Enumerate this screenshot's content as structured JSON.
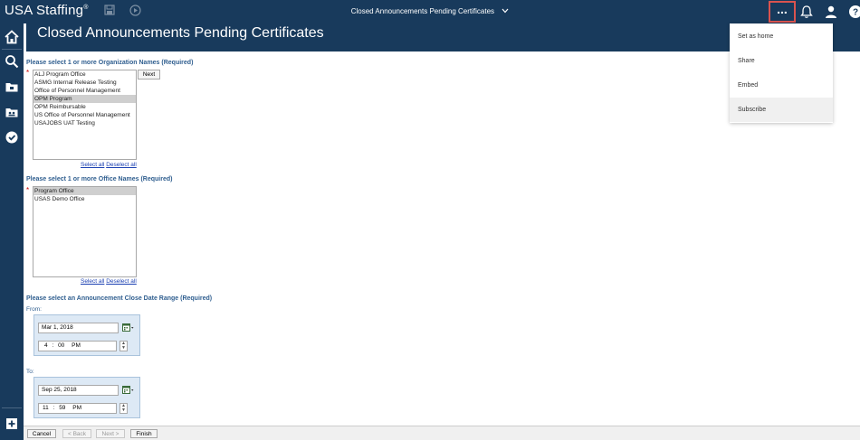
{
  "app": {
    "brand": "USA Staffing",
    "registered": "®"
  },
  "header": {
    "report_title": "Closed Announcements Pending Certificates",
    "more_label": "..."
  },
  "page": {
    "title": "Closed Announcements Pending Certificates"
  },
  "organizations": {
    "label": "Please select 1 or more Organization Names (Required)",
    "required_mark": "*",
    "options": [
      "ALJ Program Office",
      "ASMG Internal Release Testing",
      "Office of Personnel Management",
      "OPM Program",
      "OPM Reimbursable",
      "US Office of Personnel Management",
      "USAJOBS UAT Testing"
    ],
    "next_label": "Next",
    "select_all": "Select all",
    "deselect_all": "Deselect all"
  },
  "offices": {
    "label": "Please select 1 or more Office Names (Required)",
    "required_mark": "*",
    "options": [
      "Program Office",
      "USAS Demo Office"
    ],
    "select_all": "Select all",
    "deselect_all": "Deselect all"
  },
  "date_range": {
    "label": "Please select an Announcement Close Date Range (Required)",
    "from_label": "From:",
    "from_date": "Mar 1, 2018",
    "from_hour": "4",
    "from_minute": "00",
    "from_ampm": "PM",
    "to_label": "To:",
    "to_date": "Sep 25, 2018",
    "to_hour": "11",
    "to_minute": "59",
    "to_ampm": "PM",
    "colon": ":"
  },
  "footer": {
    "cancel": "Cancel",
    "back": "< Back",
    "next": "Next >",
    "finish": "Finish"
  },
  "menu": {
    "items": [
      "Set as home",
      "Share",
      "Embed",
      "Subscribe"
    ]
  },
  "colors": {
    "navy": "#183A5C",
    "accent_label": "#2F5E8F",
    "link": "#1a3fb2"
  }
}
